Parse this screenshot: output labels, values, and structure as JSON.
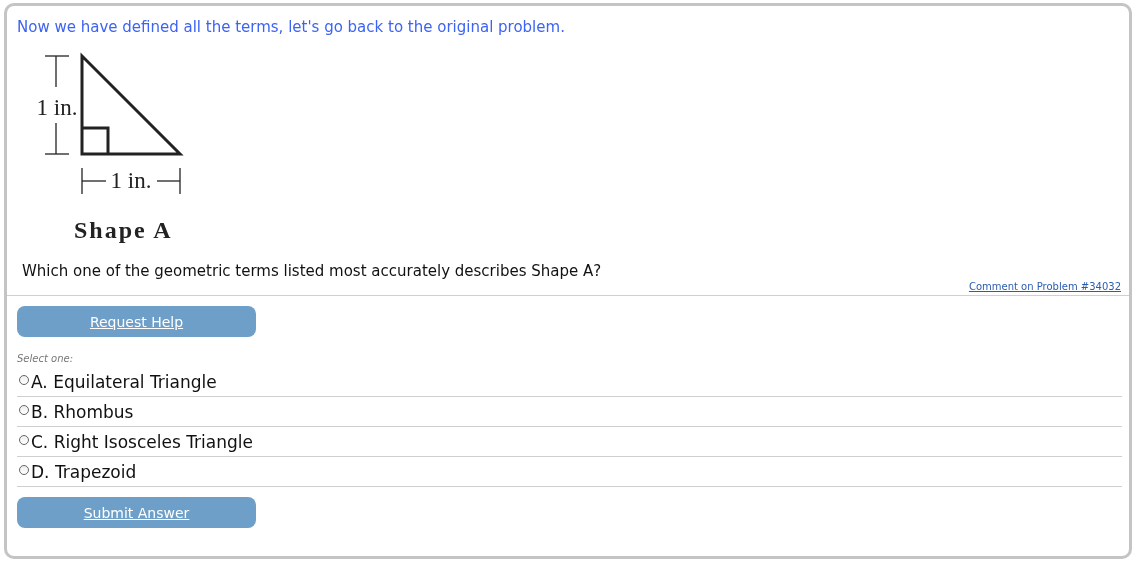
{
  "intro": "Now we have defined all the terms, let's go back to the original problem.",
  "figure": {
    "height_label": "1 in.",
    "width_label": "1 in.",
    "caption": "Shape A"
  },
  "question": "Which one of the geometric terms listed most accurately describes Shape A?",
  "comment_link": "Comment on Problem #34032",
  "help_button": "Request Help",
  "select_hint": "Select one:",
  "options": [
    {
      "label": "A. Equilateral Triangle",
      "selected": false
    },
    {
      "label": "B. Rhombus",
      "selected": false
    },
    {
      "label": "C. Right Isosceles Triangle",
      "selected": false
    },
    {
      "label": "D. Trapezoid",
      "selected": false
    }
  ],
  "submit_button": "Submit Answer"
}
